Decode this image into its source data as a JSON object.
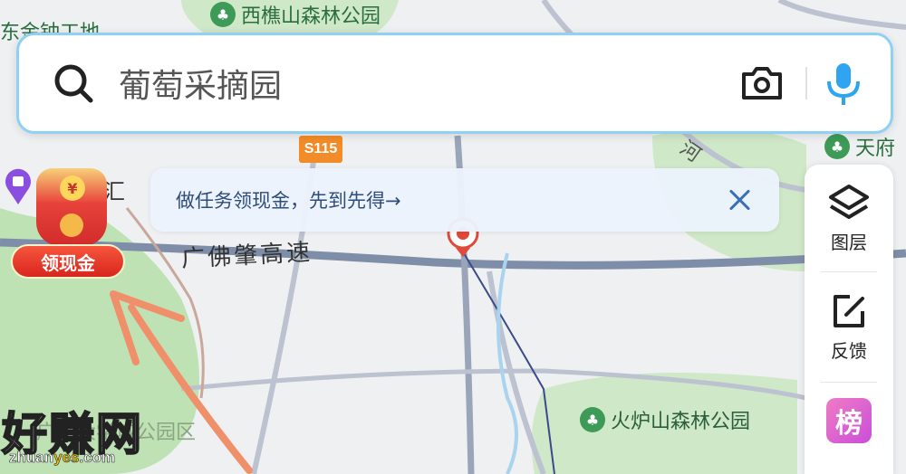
{
  "map": {
    "labels": {
      "park_top": "西樵山森林公园",
      "expressway": "广佛肇高速",
      "park_bottom": "火炉山森林公园",
      "top_left": "东金钟工地",
      "right_poi": "天府",
      "river": "河",
      "left_partial": "汇",
      "lower_left": "广州大学城公园区",
      "partial_side": "榜"
    },
    "highway_badge": "S115",
    "colors": {
      "green": "#cfe8c8",
      "road": "#bcc2d0",
      "expressway": "#7f8ea8",
      "route": "#3a4a8a"
    }
  },
  "search": {
    "query": "葡萄采摘园",
    "icons": {
      "search": "search-icon",
      "camera": "camera-icon",
      "mic": "mic-icon"
    }
  },
  "banner": {
    "text": "做任务领现金，先到先得→",
    "close": "close-icon"
  },
  "side_panel": {
    "items": [
      {
        "label": "图层",
        "icon": "layers-icon"
      },
      {
        "label": "反馈",
        "icon": "feedback-icon"
      },
      {
        "label": "榜",
        "icon": "ranking-icon"
      }
    ]
  },
  "cash_widget": {
    "button_label": "领现金",
    "coin_symbol": "¥"
  },
  "watermark": {
    "main": "好赚网",
    "sub_prefix": "zhuan",
    "sub_highlight": "yes",
    "sub_suffix": ".com"
  }
}
